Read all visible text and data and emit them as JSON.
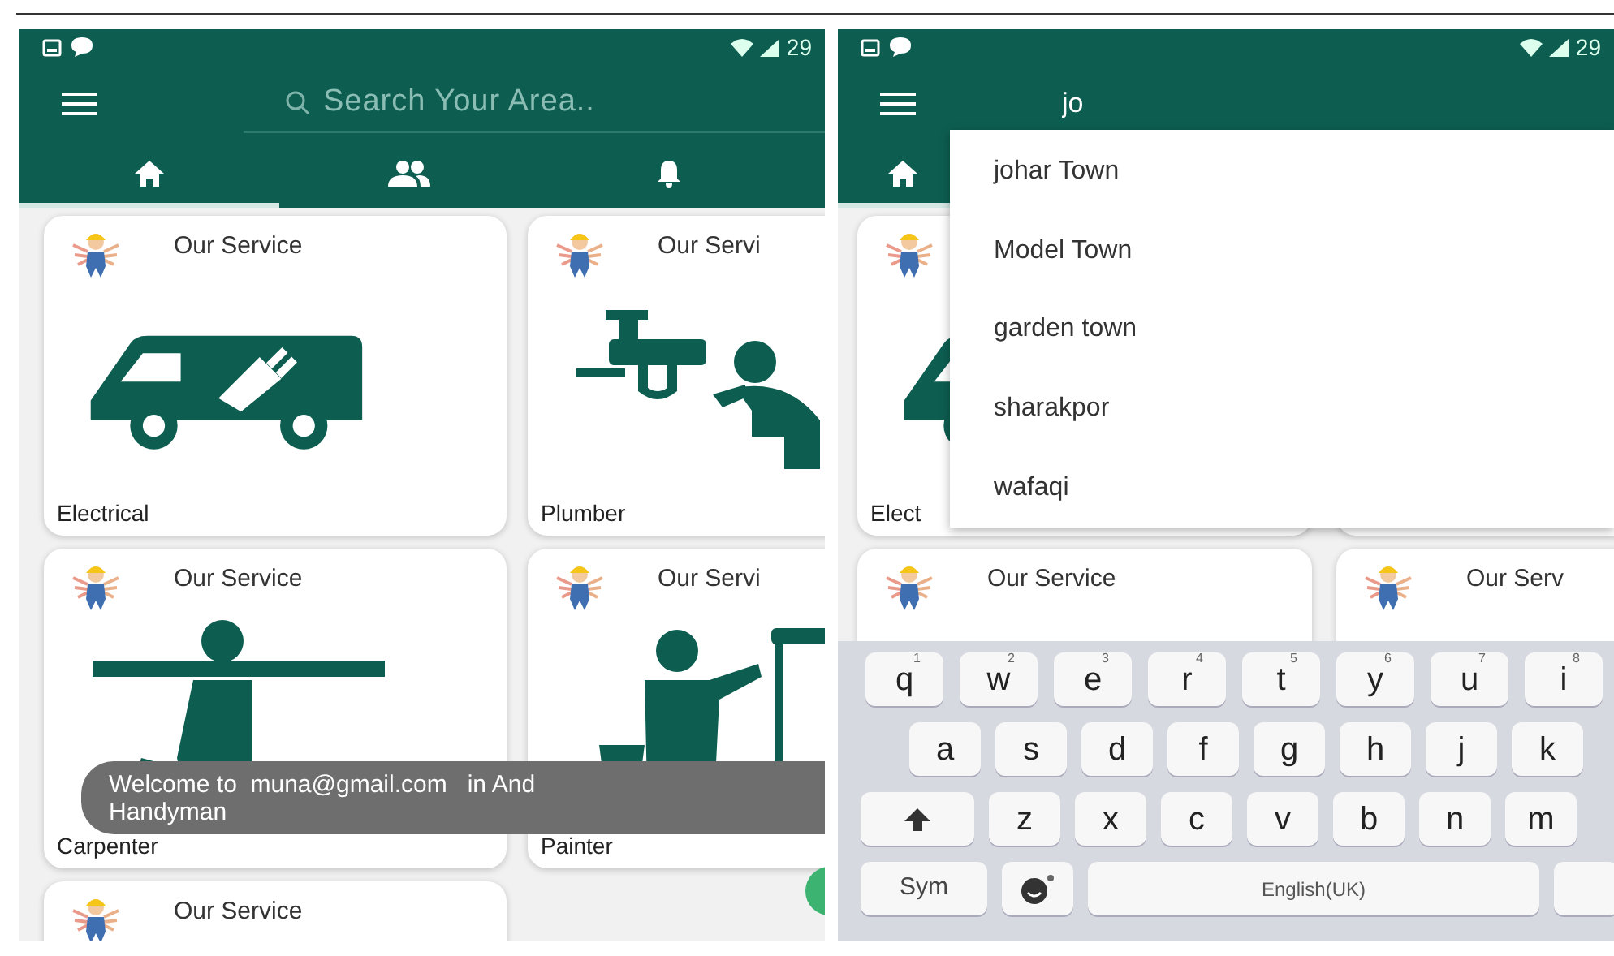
{
  "screens": [
    {
      "status_bar": {
        "battery": "29"
      },
      "search": {
        "placeholder": "Search Your Area.."
      },
      "tabs": [
        {
          "kind": "home",
          "selected": true
        },
        {
          "kind": "people",
          "selected": false
        },
        {
          "kind": "bell",
          "selected": false
        }
      ],
      "cards": [
        {
          "kind": "van",
          "avatar": true,
          "title": "Our Service",
          "label": "Electrical"
        },
        {
          "kind": "plumber",
          "avatar": true,
          "title": "Our Servi",
          "label": "Plumber"
        },
        {
          "kind": "carpenter",
          "avatar": true,
          "title": "Our Service",
          "label": "Carpenter"
        },
        {
          "kind": "painter",
          "avatar": true,
          "title": "Our Servi",
          "label": "Painter"
        },
        {
          "kind": "blank",
          "avatar": true,
          "title": "Our Service"
        }
      ],
      "toast": {
        "lines": [
          "Welcome to  muna@gmail.com   in And",
          "Handyman"
        ]
      },
      "fab": true
    },
    {
      "status_bar": {
        "battery": "29"
      },
      "search": {
        "value": "jo"
      },
      "tabs": [
        {
          "kind": "home",
          "selected": true
        }
      ],
      "cards": [
        {
          "kind": "van",
          "avatar": true,
          "label": "Elect"
        },
        {
          "kind": "blank"
        },
        {
          "kind": "blank",
          "avatar": true,
          "title": "Our Service"
        },
        {
          "kind": "blank",
          "avatar": true,
          "title": "Our Serv"
        }
      ],
      "suggestions": [
        "johar Town",
        "Model Town",
        "garden town",
        "sharakpor",
        "wafaqi"
      ],
      "keyboard": {
        "rows": [
          [
            {
              "label": "q",
              "hint": "1"
            },
            {
              "label": "w",
              "hint": "2"
            },
            {
              "label": "e",
              "hint": "3"
            },
            {
              "label": "r",
              "hint": "4"
            },
            {
              "label": "t",
              "hint": "5"
            },
            {
              "label": "y",
              "hint": "6"
            },
            {
              "label": "u",
              "hint": "7"
            },
            {
              "label": "i",
              "hint": "8"
            }
          ],
          [
            {
              "label": "a"
            },
            {
              "label": "s"
            },
            {
              "label": "d"
            },
            {
              "label": "f"
            },
            {
              "label": "g"
            },
            {
              "label": "h"
            },
            {
              "label": "j"
            },
            {
              "label": "k"
            }
          ],
          [
            {
              "kind": "shift"
            },
            {
              "label": "z"
            },
            {
              "label": "x"
            },
            {
              "label": "c"
            },
            {
              "label": "v"
            },
            {
              "label": "b"
            },
            {
              "label": "n"
            },
            {
              "label": "m"
            }
          ]
        ],
        "bottom_row": [
          {
            "kind": "wide",
            "label": "Sym"
          },
          {
            "kind": "emoji"
          },
          {
            "kind": "space",
            "label": "English(UK)"
          },
          {
            "kind": "edge"
          }
        ]
      }
    }
  ]
}
